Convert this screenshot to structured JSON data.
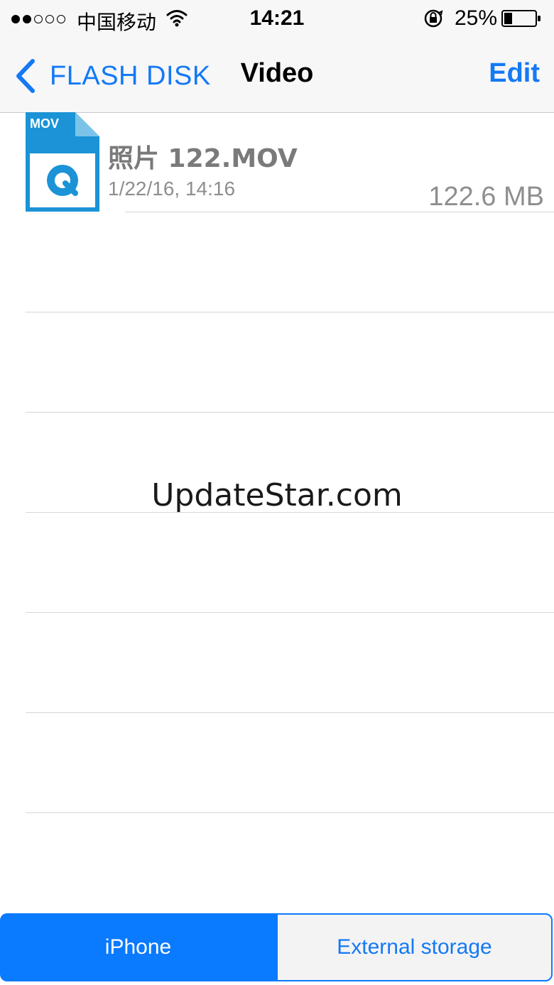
{
  "status_bar": {
    "carrier": "中国移动",
    "time": "14:21",
    "battery_percent": "25%",
    "battery_level": 0.25,
    "signal_bars_filled": 2,
    "signal_bars_total": 5,
    "icons": [
      "signal-dots-icon",
      "wifi-icon",
      "orientation-lock-icon",
      "battery-icon"
    ]
  },
  "nav": {
    "back_label": "FLASH DISK",
    "title": "Video",
    "edit_label": "Edit",
    "accent_color": "#1479f5"
  },
  "files": [
    {
      "icon_label": "MOV",
      "icon": "quicktime-file-icon",
      "name": "照片 122.MOV",
      "date": "1/22/16, 14:16",
      "size": "122.6 MB"
    }
  ],
  "watermark": "UpdateStar.com",
  "segments": {
    "active": "iPhone",
    "inactive": "External storage",
    "active_color": "#0a7aff"
  }
}
